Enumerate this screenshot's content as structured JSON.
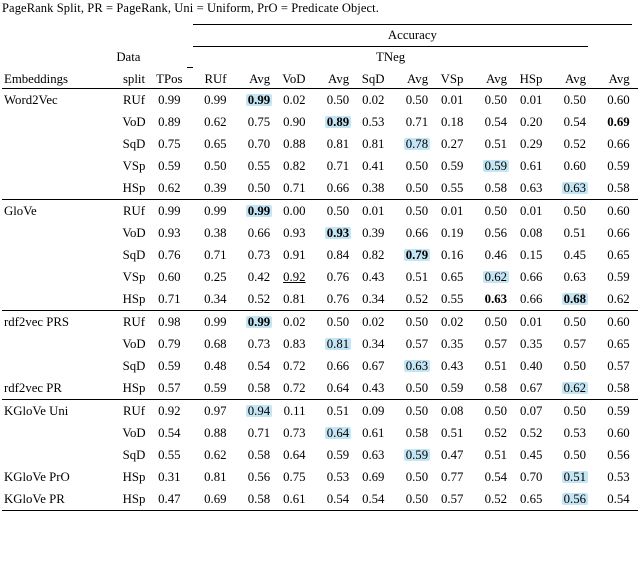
{
  "caption_fragment": "PageRank Split, PR = PageRank, Uni = Uniform, PrO = Predicate Object.",
  "header": {
    "accuracy": "Accuracy",
    "data": "Data",
    "tneg": "TNeg",
    "embeddings": "Embeddings",
    "split": "split",
    "tpos": "TPos",
    "cols": [
      "RUf",
      "Avg",
      "VoD",
      "Avg",
      "SqD",
      "Avg",
      "VSp",
      "Avg",
      "HSp",
      "Avg",
      "Avg"
    ]
  },
  "blocks": [
    {
      "name": "Word2Vec",
      "rows": [
        {
          "emb": "Word2Vec",
          "split": "RUf",
          "tpos": "0.99",
          "v": [
            "0.99",
            "0.99",
            "0.02",
            "0.50",
            "0.02",
            "0.50",
            "0.01",
            "0.50",
            "0.01",
            "0.50",
            "0.60"
          ],
          "hl": [
            1
          ],
          "bold": [
            1
          ]
        },
        {
          "emb": "",
          "split": "VoD",
          "tpos": "0.89",
          "v": [
            "0.62",
            "0.75",
            "0.90",
            "0.89",
            "0.53",
            "0.71",
            "0.18",
            "0.54",
            "0.20",
            "0.54",
            "0.69"
          ],
          "hl": [
            3
          ],
          "bold": [
            3,
            10
          ]
        },
        {
          "emb": "",
          "split": "SqD",
          "tpos": "0.75",
          "v": [
            "0.65",
            "0.70",
            "0.88",
            "0.81",
            "0.81",
            "0.78",
            "0.27",
            "0.51",
            "0.29",
            "0.52",
            "0.66"
          ],
          "hl": [
            5
          ],
          "bold": []
        },
        {
          "emb": "",
          "split": "VSp",
          "tpos": "0.59",
          "v": [
            "0.50",
            "0.55",
            "0.82",
            "0.71",
            "0.41",
            "0.50",
            "0.59",
            "0.59",
            "0.61",
            "0.60",
            "0.59"
          ],
          "hl": [
            7
          ],
          "bold": []
        },
        {
          "emb": "",
          "split": "HSp",
          "tpos": "0.62",
          "v": [
            "0.39",
            "0.50",
            "0.71",
            "0.66",
            "0.38",
            "0.50",
            "0.55",
            "0.58",
            "0.63",
            "0.63",
            "0.58"
          ],
          "hl": [
            9
          ],
          "bold": []
        }
      ]
    },
    {
      "name": "GloVe",
      "rows": [
        {
          "emb": "GloVe",
          "split": "RUf",
          "tpos": "0.99",
          "v": [
            "0.99",
            "0.99",
            "0.00",
            "0.50",
            "0.01",
            "0.50",
            "0.01",
            "0.50",
            "0.01",
            "0.50",
            "0.60"
          ],
          "hl": [
            1
          ],
          "bold": [
            1
          ]
        },
        {
          "emb": "",
          "split": "VoD",
          "tpos": "0.93",
          "v": [
            "0.38",
            "0.66",
            "0.93",
            "0.93",
            "0.39",
            "0.66",
            "0.19",
            "0.56",
            "0.08",
            "0.51",
            "0.66"
          ],
          "hl": [
            3
          ],
          "bold": [
            3
          ]
        },
        {
          "emb": "",
          "split": "SqD",
          "tpos": "0.76",
          "v": [
            "0.71",
            "0.73",
            "0.91",
            "0.84",
            "0.82",
            "0.79",
            "0.16",
            "0.46",
            "0.15",
            "0.45",
            "0.65"
          ],
          "hl": [
            5
          ],
          "bold": [
            5
          ]
        },
        {
          "emb": "",
          "split": "VSp",
          "tpos": "0.60",
          "v": [
            "0.25",
            "0.42",
            "0.92",
            "0.76",
            "0.43",
            "0.51",
            "0.65",
            "0.62",
            "0.66",
            "0.63",
            "0.59"
          ],
          "hl": [
            7
          ],
          "bold": [],
          "under": [
            2
          ]
        },
        {
          "emb": "",
          "split": "HSp",
          "tpos": "0.71",
          "v": [
            "0.34",
            "0.52",
            "0.81",
            "0.76",
            "0.34",
            "0.52",
            "0.55",
            "0.63",
            "0.66",
            "0.68",
            "0.62"
          ],
          "hl": [
            9
          ],
          "bold": [
            7,
            9
          ]
        }
      ]
    },
    {
      "name": "rdf2vec",
      "rows": [
        {
          "emb": "rdf2vec PRS",
          "split": "RUf",
          "tpos": "0.98",
          "v": [
            "0.99",
            "0.99",
            "0.02",
            "0.50",
            "0.02",
            "0.50",
            "0.02",
            "0.50",
            "0.01",
            "0.50",
            "0.60"
          ],
          "hl": [
            1
          ],
          "bold": [
            1
          ]
        },
        {
          "emb": "",
          "split": "VoD",
          "tpos": "0.79",
          "v": [
            "0.68",
            "0.73",
            "0.83",
            "0.81",
            "0.34",
            "0.57",
            "0.35",
            "0.57",
            "0.35",
            "0.57",
            "0.65"
          ],
          "hl": [
            3
          ],
          "bold": []
        },
        {
          "emb": "",
          "split": "SqD",
          "tpos": "0.59",
          "v": [
            "0.48",
            "0.54",
            "0.72",
            "0.66",
            "0.67",
            "0.63",
            "0.43",
            "0.51",
            "0.40",
            "0.50",
            "0.57"
          ],
          "hl": [
            5
          ],
          "bold": []
        },
        {
          "emb": "rdf2vec PR",
          "split": "HSp",
          "tpos": "0.57",
          "v": [
            "0.59",
            "0.58",
            "0.72",
            "0.64",
            "0.43",
            "0.50",
            "0.59",
            "0.58",
            "0.67",
            "0.62",
            "0.58"
          ],
          "hl": [
            9
          ],
          "bold": []
        }
      ]
    },
    {
      "name": "KGloVe",
      "rows": [
        {
          "emb": "KGloVe Uni",
          "split": "RUf",
          "tpos": "0.92",
          "v": [
            "0.97",
            "0.94",
            "0.11",
            "0.51",
            "0.09",
            "0.50",
            "0.08",
            "0.50",
            "0.07",
            "0.50",
            "0.59"
          ],
          "hl": [
            1
          ],
          "bold": []
        },
        {
          "emb": "",
          "split": "VoD",
          "tpos": "0.54",
          "v": [
            "0.88",
            "0.71",
            "0.73",
            "0.64",
            "0.61",
            "0.58",
            "0.51",
            "0.52",
            "0.52",
            "0.53",
            "0.60"
          ],
          "hl": [
            3
          ],
          "bold": []
        },
        {
          "emb": "",
          "split": "SqD",
          "tpos": "0.55",
          "v": [
            "0.62",
            "0.58",
            "0.64",
            "0.59",
            "0.63",
            "0.59",
            "0.47",
            "0.51",
            "0.45",
            "0.50",
            "0.56"
          ],
          "hl": [
            5
          ],
          "bold": []
        },
        {
          "emb": "KGloVe PrO",
          "split": "HSp",
          "tpos": "0.31",
          "v": [
            "0.81",
            "0.56",
            "0.75",
            "0.53",
            "0.69",
            "0.50",
            "0.77",
            "0.54",
            "0.70",
            "0.51",
            "0.53"
          ],
          "hl": [
            9
          ],
          "bold": []
        },
        {
          "emb": "KGloVe PR",
          "split": "HSp",
          "tpos": "0.47",
          "v": [
            "0.69",
            "0.58",
            "0.61",
            "0.54",
            "0.54",
            "0.50",
            "0.57",
            "0.52",
            "0.65",
            "0.56",
            "0.54"
          ],
          "hl": [
            9
          ],
          "bold": []
        }
      ]
    }
  ]
}
